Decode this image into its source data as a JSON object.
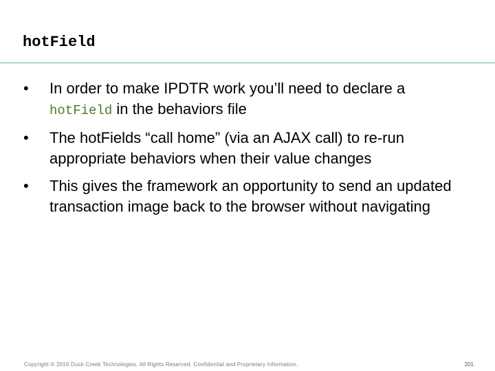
{
  "slide": {
    "title": "hotField",
    "bullets": [
      {
        "symbol": "•",
        "before": "In order to make IPDTR work you’ll need to declare a ",
        "code": "hotField",
        "after": " in the behaviors file"
      },
      {
        "symbol": "•",
        "text": "The hotFields “call home” (via an AJAX call) to re-run appropriate behaviors when their value changes"
      },
      {
        "symbol": "•",
        "text": "This gives the framework an opportunity to send an updated transaction image back to the browser without navigating"
      }
    ]
  },
  "footer": {
    "copyright": "Copyright © 2016 Duck Creek Technologies. All Rights Reserved. Confidential and Proprietary Information.",
    "page_number": "201"
  },
  "colors": {
    "rule": "#6fa6a0",
    "code": "#4f7a2e"
  }
}
